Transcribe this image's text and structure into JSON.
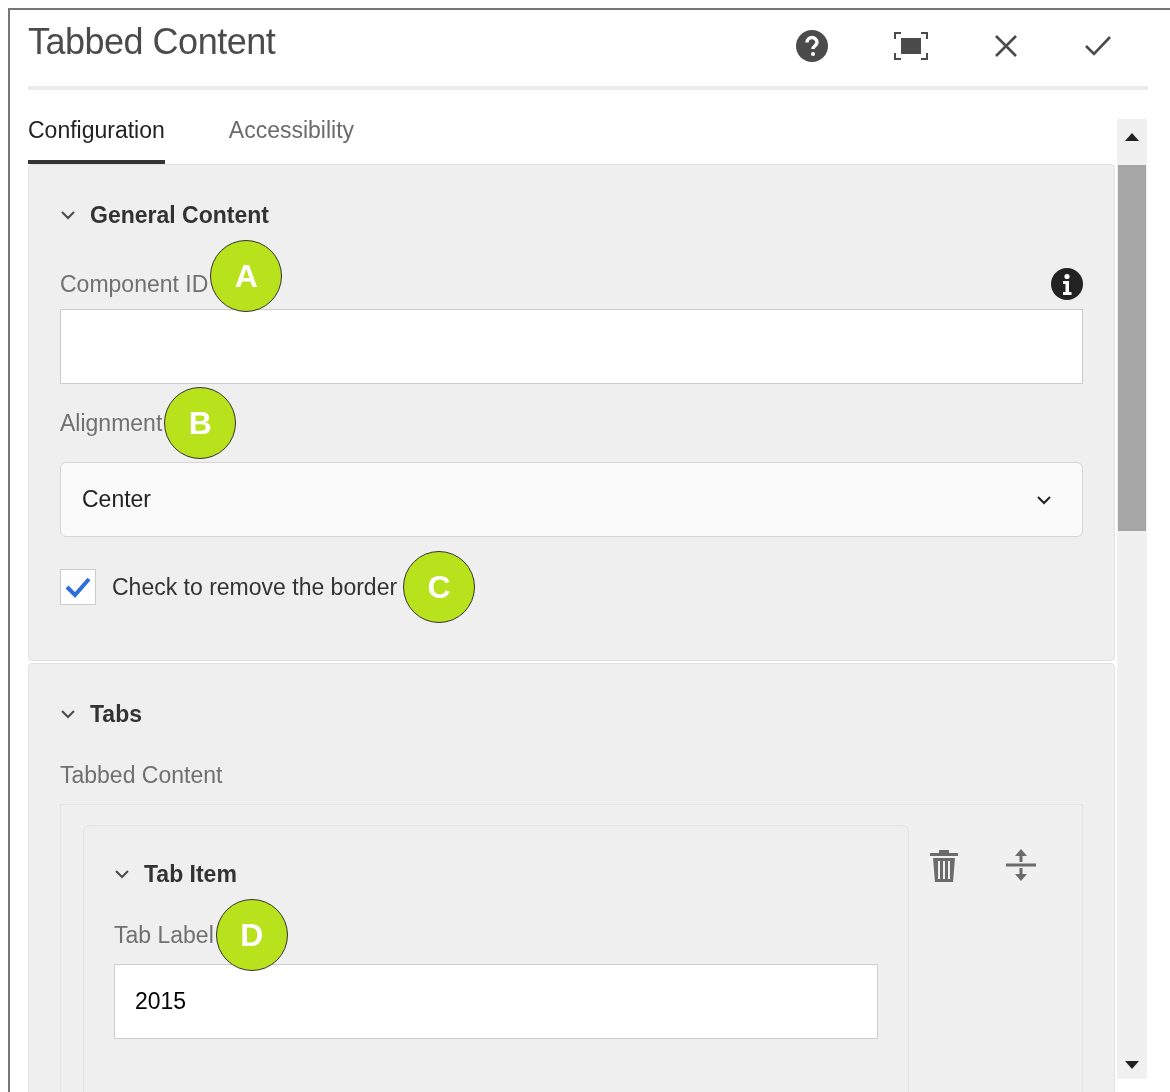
{
  "dialog": {
    "title": "Tabbed Content"
  },
  "tabs": [
    {
      "label": "Configuration",
      "selected": true
    },
    {
      "label": "Accessibility",
      "selected": false
    }
  ],
  "general_content": {
    "title": "General Content",
    "expanded": true,
    "component_id": {
      "label": "Component ID",
      "callout": "A"
    },
    "alignment": {
      "label": "Alignment",
      "callout": "B",
      "value": "Center"
    },
    "remove_border": {
      "label": "Check to remove the border",
      "checked": true,
      "callout": "C"
    }
  },
  "tabs_section": {
    "title": "Tabs",
    "expanded": true,
    "multifield_label": "Tabbed Content",
    "items": [
      {
        "title": "Tab Item",
        "expanded": true,
        "tab_label": {
          "label": "Tab Label",
          "callout": "D",
          "value": "2015"
        }
      }
    ]
  }
}
